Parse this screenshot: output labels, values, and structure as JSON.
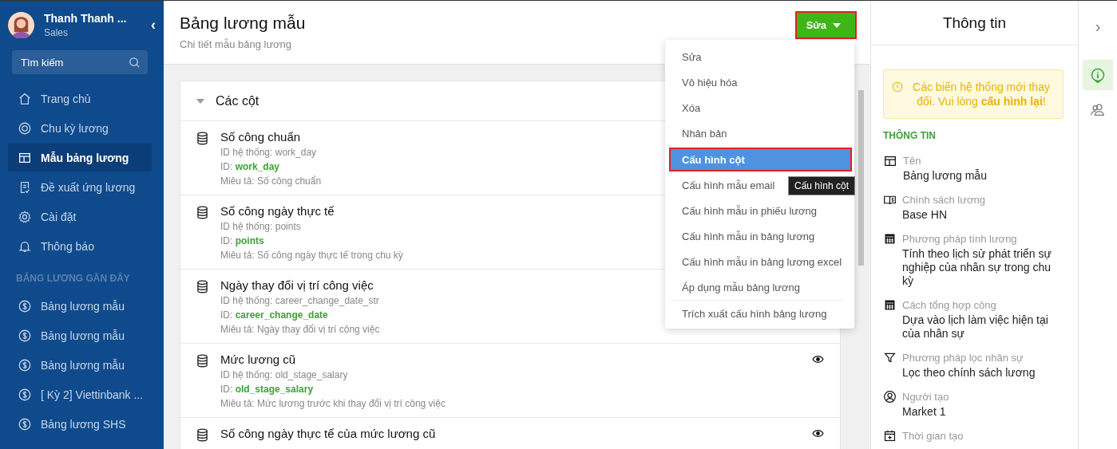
{
  "sidebar": {
    "user": {
      "name": "Thanh Thanh ...",
      "role": "Sales"
    },
    "collapse_icon": "‹",
    "search": {
      "placeholder": "Tìm kiếm"
    },
    "nav": [
      {
        "label": "Trang chủ",
        "kind": "home",
        "selected": false
      },
      {
        "label": "Chu kỳ lương",
        "kind": "cycle",
        "selected": false
      },
      {
        "label": "Mẫu bảng lương",
        "kind": "layout",
        "selected": true
      },
      {
        "label": "Đề xuất ứng lương",
        "kind": "request",
        "selected": false
      },
      {
        "label": "Cài đặt",
        "kind": "gear",
        "selected": false
      },
      {
        "label": "Thông báo",
        "kind": "bell",
        "selected": false
      }
    ],
    "recent_heading": "BẢNG LƯƠNG GẦN ĐÂY",
    "recent": [
      {
        "label": "Bảng lương mẫu",
        "selected": false
      },
      {
        "label": "Bảng lương mẫu",
        "selected": false
      },
      {
        "label": "Bảng lương mẫu",
        "selected": false
      },
      {
        "label": "[ Kỳ 2] Viettinbank ...",
        "selected": false
      },
      {
        "label": "Bảng lương SHS",
        "selected": false
      }
    ]
  },
  "header": {
    "title": "Bảng lương mẫu",
    "subtitle": "Chi tiết mẫu bảng lương",
    "edit_button": "Sửa",
    "edit_button_highlighted": true
  },
  "columns_card": {
    "title": "Các cột",
    "expanded": true,
    "rows": [
      {
        "name": "Số công chuẩn",
        "system_id": "ID hệ thống: work_day",
        "id_label": "ID: ",
        "id": "work_day",
        "description": "Miêu tả: Số công chuẩn"
      },
      {
        "name": "Số công ngày thực tế",
        "system_id": "ID hệ thống: points",
        "id_label": "ID: ",
        "id": "points",
        "description": "Miêu tả: Số công ngày thực tế trong chu kỳ"
      },
      {
        "name": "Ngày thay đổi vị trí công việc",
        "system_id": "ID hệ thống: career_change_date_str",
        "id_label": "ID: ",
        "id": "career_change_date",
        "description": "Miêu tả: Ngày thay đổi vị trí công việc"
      },
      {
        "name": "Mức lương cũ",
        "system_id": "ID hệ thống: old_stage_salary",
        "id_label": "ID: ",
        "id": "old_stage_salary",
        "description": "Miêu tả: Mức lương trước khi thay đổi vị trí công việc",
        "eye_shown": true
      },
      {
        "name": "Số công ngày thực tế của mức lương cũ",
        "eye_shown": true
      }
    ]
  },
  "dropdown_menu": {
    "groups": [
      {
        "items": [
          {
            "label": "Sửa",
            "selected": false
          },
          {
            "label": "Vô hiệu hóa",
            "selected": false
          },
          {
            "label": "Xóa",
            "selected": false
          },
          {
            "label": "Nhân bản",
            "selected": false
          }
        ]
      },
      {
        "items": [
          {
            "label": "Cấu hình cột",
            "selected": true
          },
          {
            "label": "Cấu hình mẫu email",
            "selected": false
          },
          {
            "label": "Cấu hình mẫu in phiếu lương",
            "selected": false
          },
          {
            "label": "Cấu hình mẫu in bảng lương",
            "selected": false
          },
          {
            "label": "Cấu hình mẫu in bảng lương excel",
            "selected": false
          },
          {
            "label": "Áp dụng mẫu bảng lương",
            "selected": false
          }
        ]
      },
      {
        "items": [
          {
            "label": "Trích xuất cấu hình bảng lương",
            "selected": false
          }
        ]
      }
    ],
    "tooltip": "Cấu hình cột"
  },
  "info_panel": {
    "title": "Thông tin",
    "alert": "Các biến hệ thống mới thay đổi. Vui lòng **cấu hình lại**!",
    "section": "THÔNG TIN",
    "fields": [
      {
        "kind": "layout",
        "label": "Tên",
        "value": "Bảng lương mẫu"
      },
      {
        "kind": "book",
        "label": "Chính sách lương",
        "value": "Base HN"
      },
      {
        "kind": "calculator",
        "label": "Phương pháp tính lương",
        "value": "Tính theo lịch sử phát triển sự nghiệp của nhân sự trong chu kỳ"
      },
      {
        "kind": "calculator",
        "label": "Cách tổng hợp công",
        "value": "Dựa vào lịch làm việc hiện tại của nhân sự"
      },
      {
        "kind": "filter",
        "label": "Phương pháp lọc nhân sự",
        "value": "Lọc theo chính sách lương"
      },
      {
        "kind": "user",
        "label": "Người tạo",
        "value": "Market 1"
      },
      {
        "kind": "calendar",
        "label": "Thời gian tạo"
      }
    ]
  },
  "right_rail": {
    "expand_icon": "›",
    "tabs": [
      {
        "kind": "info",
        "selected": true
      },
      {
        "kind": "people",
        "selected": false
      }
    ]
  }
}
